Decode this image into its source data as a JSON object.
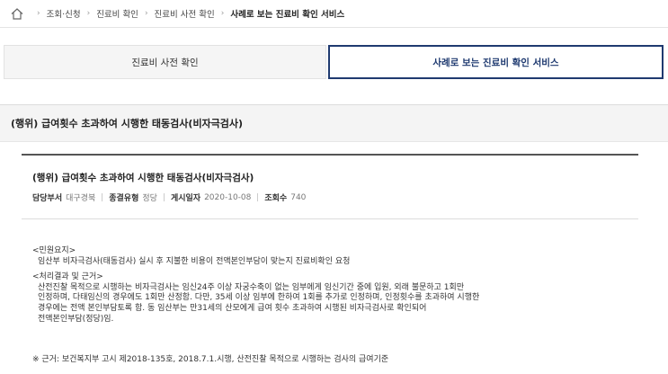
{
  "breadcrumb": {
    "items": [
      "조회·신청",
      "진료비 확인",
      "진료비 사전 확인"
    ],
    "current": "사례로 보는 진료비 확인 서비스"
  },
  "tabs": [
    {
      "label": "진료비 사전 확인",
      "active": false
    },
    {
      "label": "사례로 보는 진료비 확인 서비스",
      "active": true
    }
  ],
  "section_title": "(행위) 급여횟수 초과하여 시행한 태동검사(비자극검사)",
  "case": {
    "title": "(행위) 급여횟수 초과하여 시행한 태동검사(비자극검사)",
    "dept_label": "담당부서",
    "dept_value": "대구경북",
    "type_label": "종결유형",
    "type_value": "정당",
    "date_label": "게시일자",
    "date_value": "2020-10-08",
    "views_label": "조회수",
    "views_value": "740"
  },
  "complaint": {
    "heading": "<민원요지>",
    "text": "임산부 비자극검사(태동검사) 실시 후 지불한 비용이 전액본인부담이 맞는지 진료비확인 요청"
  },
  "result": {
    "heading": "<처리결과 및 근거>",
    "lines": [
      "산전진찰 목적으로 시행하는 비자극검사는 임신24주 이상 자궁수축이 없는 임부에게 임신기간 중에 입원, 외래 불문하고 1회만",
      "인정하며, 다태임신의 경우에도 1회만 산정함. 다만, 35세 이상 임부에 한하여 1회를 추가로 인정하며, 인정횟수를 초과하여 시행한",
      "경우에는 전액 본인부담토록 함. 동 임산부는 만31세의 산모에게 급여 횟수 초과하여 시행된 비자극검사로 확인되어",
      "전액본인부담(정당)임."
    ]
  },
  "note": "※ 근거: 보건복지부 고시 제2018-135호, 2018.7.1.시행, 산전진찰 목적으로 시행하는 검사의 급여기준"
}
